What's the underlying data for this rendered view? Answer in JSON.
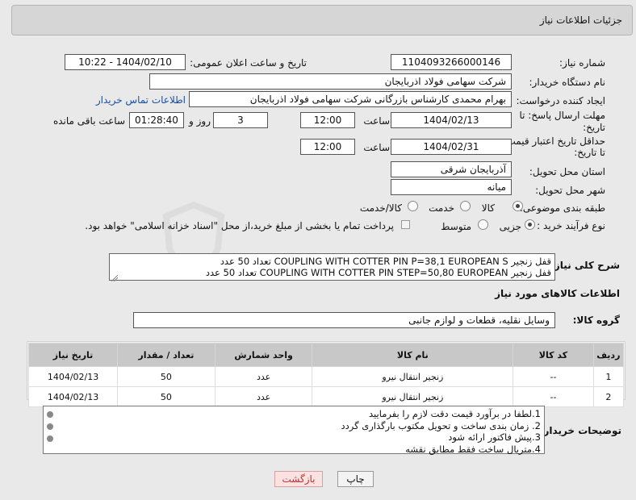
{
  "header": {
    "title": "جزئیات اطلاعات نیاز"
  },
  "form": {
    "need_number_label": "شماره نیاز:",
    "need_number": "1104093266000146",
    "announce_label": "تاریخ و ساعت اعلان عمومی:",
    "announce_value": "1404/02/10 - 10:22",
    "buyer_org_label": "نام دستگاه خریدار:",
    "buyer_org": "شرکت سهامی فولاد اذربایجان",
    "requester_label": "ایجاد کننده درخواست:",
    "requester": "بهرام محمدی کارشناس بازرگانی شرکت سهامی فولاد اذربایجان",
    "contact_link": "اطلاعات تماس خریدار",
    "deadline_label_1": "مهلت ارسال پاسخ: تا",
    "deadline_label_2": "تاریخ:",
    "deadline_date": "1404/02/13",
    "time_label": "ساعت",
    "deadline_time": "12:00",
    "days_value": "3",
    "days_label": "روز و",
    "remaining_time": "01:28:40",
    "remaining_label": "ساعت باقی مانده",
    "validity_label_1": "حداقل تاریخ اعتبار قیمت:",
    "validity_label_2": "تا تاریخ:",
    "validity_date": "1404/02/31",
    "validity_time": "12:00",
    "province_label": "استان محل تحویل:",
    "province": "آذربایجان شرقی",
    "city_label": "شهر محل تحویل:",
    "city": "میانه",
    "category_label": "طبقه بندی موضوعی:",
    "category_options": [
      "کالا",
      "خدمت",
      "کالا/خدمت"
    ],
    "category_selected": "کالا",
    "process_label": "نوع فرآیند خرید :",
    "process_options": [
      "جزیی",
      "متوسط"
    ],
    "process_selected": "جزیی",
    "payment_note": "پرداخت تمام یا بخشی از مبلغ خرید،از محل \"اسناد خزانه اسلامی\" خواهد بود."
  },
  "description": {
    "label": "شرح کلی نیاز:",
    "lines": [
      "قفل زنجیر COUPLING WITH COTTER PIN P=38,1 EUROPEAN S تعداد 50 عدد",
      "قفل زنجیر COUPLING WITH COTTER PIN STEP=50,80 EUROPEAN  تعداد 50 عدد"
    ]
  },
  "goods": {
    "section_title": "اطلاعات کالاهای مورد نیاز",
    "group_label": "گروه کالا:",
    "group_value": "وسایل نقلیه، قطعات و لوازم جانبی",
    "columns": [
      "ردیف",
      "کد کالا",
      "نام کالا",
      "واحد شمارش",
      "تعداد / مقدار",
      "تاریخ نیاز"
    ],
    "rows": [
      [
        "1",
        "--",
        "زنجیر انتقال نیرو",
        "عدد",
        "50",
        "1404/02/13"
      ],
      [
        "2",
        "--",
        "زنجیر انتقال نیرو",
        "عدد",
        "50",
        "1404/02/13"
      ]
    ]
  },
  "buyer_notes": {
    "label": "توضیحات خریدار:",
    "lines": [
      "1.لطفا در برآورد قیمت دقت لازم را بفرمایید",
      "2. زمان بندی ساخت و تحویل مکتوب بارگذاری گردد",
      "3.پیش فاکتور ارائه شود",
      "4.متریال ساخت فقط مطابق نقشه"
    ]
  },
  "buttons": {
    "print": "چاپ",
    "back": "بازگشت"
  },
  "watermark": "AriaTender.neT"
}
